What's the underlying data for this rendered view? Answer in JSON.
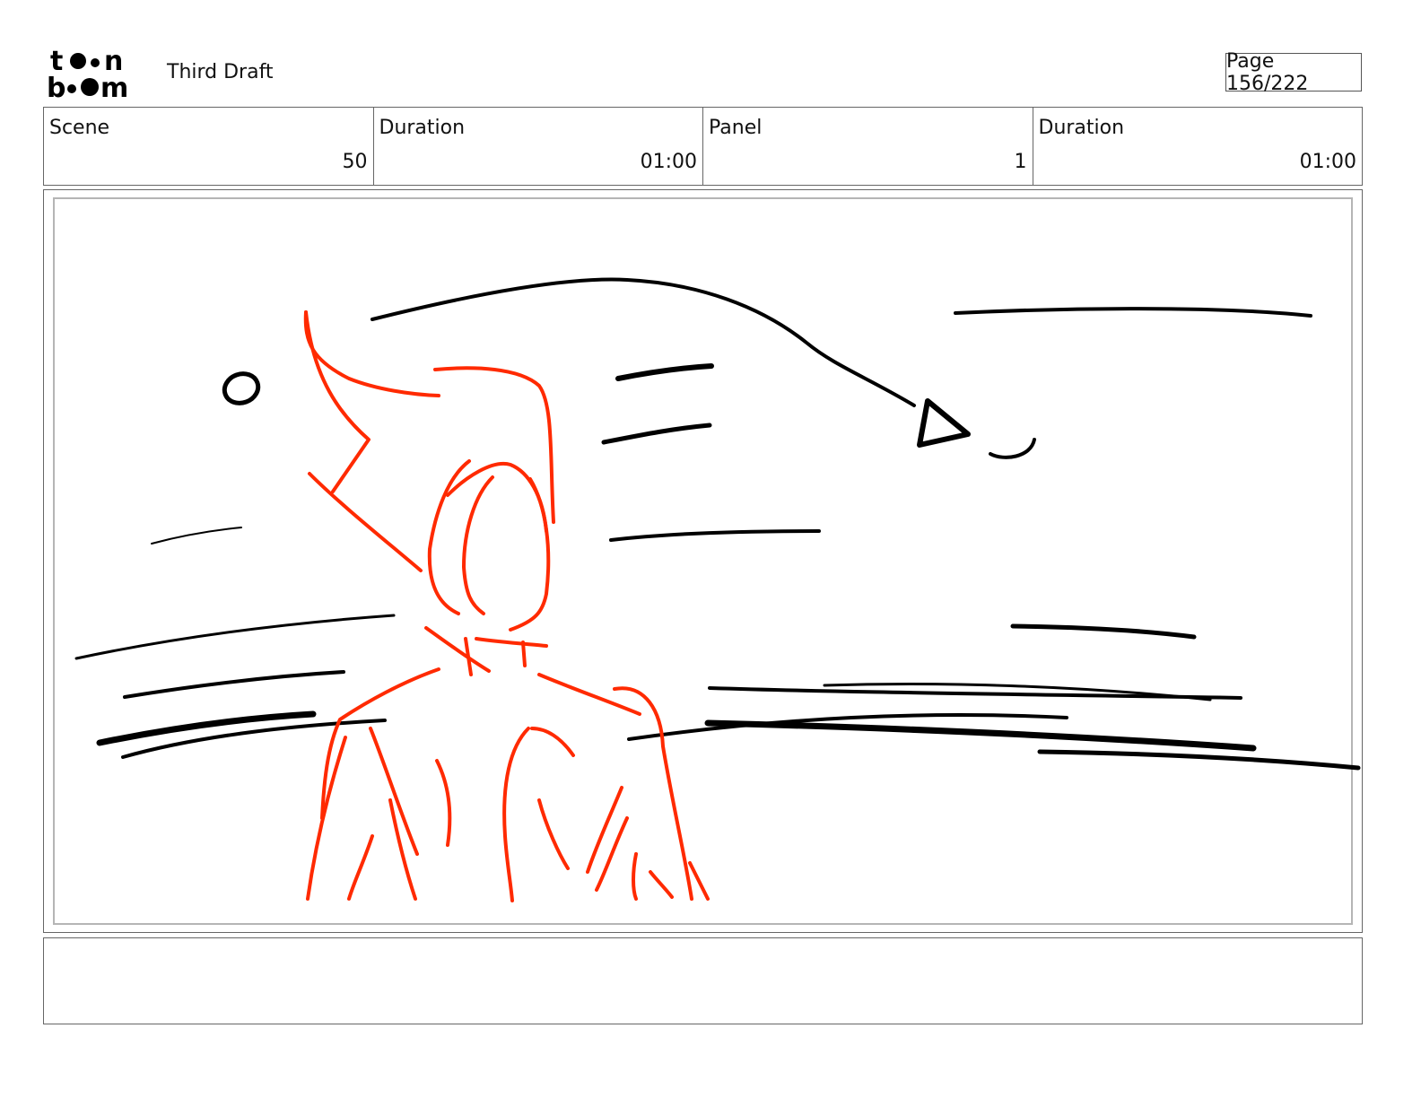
{
  "header": {
    "logo_top": "toon",
    "logo_bottom": "boom",
    "title": "Third Draft",
    "page": "Page 156/222"
  },
  "info": [
    {
      "label": "Scene",
      "value": "50"
    },
    {
      "label": "Duration",
      "value": "01:00"
    },
    {
      "label": "Panel",
      "value": "1"
    },
    {
      "label": "Duration",
      "value": "01:00"
    }
  ],
  "panel": {
    "ink_colors": {
      "character": "#ff2a00",
      "motion": "#000000"
    }
  },
  "notes": {
    "text": ""
  }
}
